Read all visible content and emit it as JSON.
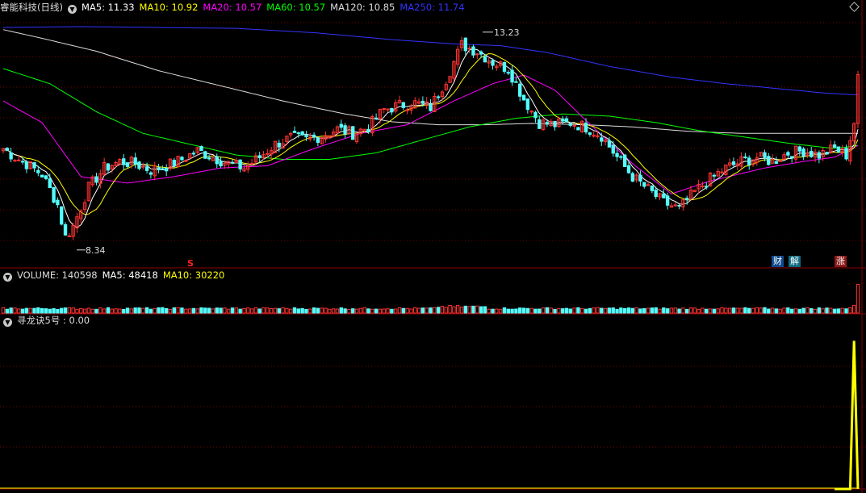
{
  "main_header": {
    "stock_title": "睿能科技(日线)",
    "indicators": [
      {
        "label": "MA5: 11.33",
        "color": "#ffffff"
      },
      {
        "label": "MA10: 10.92",
        "color": "#ffff00"
      },
      {
        "label": "MA20: 10.57",
        "color": "#ff00ff"
      },
      {
        "label": "MA60: 10.57",
        "color": "#00ff00"
      },
      {
        "label": "MA120: 10.85",
        "color": "#dddddd"
      },
      {
        "label": "MA250: 11.74",
        "color": "#3333ff"
      }
    ]
  },
  "volume_header": {
    "label": "VOLUME: 140598",
    "ma5": "MA5: 48418",
    "ma10": "MA10: 30220"
  },
  "indicator_header": {
    "label": "寻龙诀5号 : 0.00"
  },
  "annotations": {
    "high_label": "13.23",
    "low_label": "8.34",
    "s_marker": "S",
    "badge_cai": "财",
    "badge_jie": "解",
    "badge_zhang": "涨"
  },
  "colors": {
    "up": "#ff3333",
    "down": "#54fcfc",
    "ma5": "#ffffff",
    "ma10": "#ffff00",
    "ma20": "#ff00ff",
    "ma60": "#00ff00",
    "ma120": "#dddddd",
    "ma250": "#3333ff",
    "grid": "#7a0000",
    "signal": "#ffff00"
  },
  "chart_data": [
    {
      "type": "candlestick",
      "title": "睿能科技(日线)",
      "annotations": {
        "high": 13.23,
        "low": 8.34
      },
      "close_anchors": [
        [
          0,
          10.5
        ],
        [
          3,
          10.3
        ],
        [
          6,
          10.15
        ],
        [
          10,
          9.9
        ],
        [
          14,
          9.2
        ],
        [
          16,
          8.45
        ],
        [
          18,
          8.7
        ],
        [
          22,
          9.6
        ],
        [
          26,
          10.05
        ],
        [
          30,
          10.2
        ],
        [
          34,
          10.15
        ],
        [
          38,
          10.0
        ],
        [
          42,
          10.1
        ],
        [
          46,
          10.25
        ],
        [
          50,
          10.45
        ],
        [
          54,
          10.3
        ],
        [
          58,
          10.15
        ],
        [
          62,
          10.05
        ],
        [
          66,
          10.3
        ],
        [
          70,
          10.6
        ],
        [
          74,
          10.75
        ],
        [
          78,
          10.7
        ],
        [
          82,
          10.8
        ],
        [
          86,
          10.95
        ],
        [
          90,
          10.85
        ],
        [
          94,
          11.0
        ],
        [
          98,
          11.4
        ],
        [
          102,
          11.5
        ],
        [
          106,
          11.55
        ],
        [
          110,
          11.45
        ],
        [
          114,
          12.1
        ],
        [
          118,
          12.9
        ],
        [
          122,
          12.75
        ],
        [
          126,
          12.5
        ],
        [
          130,
          12.35
        ],
        [
          134,
          11.65
        ],
        [
          138,
          11.1
        ],
        [
          142,
          11.05
        ],
        [
          146,
          11.1
        ],
        [
          150,
          11.0
        ],
        [
          154,
          10.8
        ],
        [
          158,
          10.3
        ],
        [
          162,
          9.85
        ],
        [
          166,
          9.55
        ],
        [
          170,
          9.25
        ],
        [
          174,
          9.1
        ],
        [
          178,
          9.5
        ],
        [
          182,
          9.8
        ],
        [
          186,
          10.05
        ],
        [
          190,
          10.2
        ],
        [
          194,
          10.3
        ],
        [
          198,
          10.2
        ],
        [
          202,
          10.4
        ],
        [
          206,
          10.45
        ],
        [
          210,
          10.35
        ],
        [
          214,
          10.5
        ],
        [
          217,
          10.35
        ],
        [
          219,
          11.1
        ],
        [
          220,
          12.1
        ]
      ],
      "ma_anchors": {
        "MA20": [
          [
            0,
            11.6
          ],
          [
            10,
            11.1
          ],
          [
            20,
            9.85
          ],
          [
            32,
            9.7
          ],
          [
            44,
            9.85
          ],
          [
            56,
            10.05
          ],
          [
            68,
            10.1
          ],
          [
            80,
            10.5
          ],
          [
            92,
            10.85
          ],
          [
            104,
            11.05
          ],
          [
            116,
            11.6
          ],
          [
            126,
            12.0
          ],
          [
            134,
            12.2
          ],
          [
            142,
            11.85
          ],
          [
            150,
            11.15
          ],
          [
            162,
            10.15
          ],
          [
            172,
            9.45
          ],
          [
            182,
            9.75
          ],
          [
            196,
            10.05
          ],
          [
            206,
            10.2
          ],
          [
            214,
            10.3
          ],
          [
            220,
            10.57
          ]
        ],
        "MA60": [
          [
            0,
            12.35
          ],
          [
            12,
            12.0
          ],
          [
            24,
            11.35
          ],
          [
            36,
            10.85
          ],
          [
            48,
            10.6
          ],
          [
            60,
            10.35
          ],
          [
            72,
            10.25
          ],
          [
            84,
            10.25
          ],
          [
            96,
            10.4
          ],
          [
            108,
            10.7
          ],
          [
            120,
            11.0
          ],
          [
            132,
            11.2
          ],
          [
            144,
            11.3
          ],
          [
            156,
            11.25
          ],
          [
            168,
            11.1
          ],
          [
            180,
            10.9
          ],
          [
            192,
            10.75
          ],
          [
            204,
            10.6
          ],
          [
            214,
            10.5
          ],
          [
            220,
            10.57
          ]
        ],
        "MA120": [
          [
            0,
            13.25
          ],
          [
            10,
            13.05
          ],
          [
            24,
            12.75
          ],
          [
            40,
            12.3
          ],
          [
            56,
            11.95
          ],
          [
            72,
            11.6
          ],
          [
            88,
            11.3
          ],
          [
            100,
            11.12
          ],
          [
            112,
            11.05
          ],
          [
            124,
            11.05
          ],
          [
            136,
            11.08
          ],
          [
            150,
            11.05
          ],
          [
            162,
            11.0
          ],
          [
            176,
            10.9
          ],
          [
            190,
            10.85
          ],
          [
            204,
            10.85
          ],
          [
            214,
            10.85
          ],
          [
            220,
            10.85
          ]
        ],
        "MA250": [
          [
            0,
            13.3
          ],
          [
            20,
            13.32
          ],
          [
            40,
            13.3
          ],
          [
            60,
            13.28
          ],
          [
            80,
            13.18
          ],
          [
            100,
            13.02
          ],
          [
            116,
            12.92
          ],
          [
            128,
            12.88
          ],
          [
            140,
            12.72
          ],
          [
            156,
            12.4
          ],
          [
            172,
            12.15
          ],
          [
            186,
            12.0
          ],
          [
            200,
            11.88
          ],
          [
            212,
            11.78
          ],
          [
            220,
            11.74
          ]
        ]
      },
      "ylim": [
        8.0,
        13.6
      ],
      "grid": true,
      "n_bars": 221
    },
    {
      "type": "bar",
      "title": "VOLUME",
      "values": {
        "last": 140598,
        "ma5": 48418,
        "ma10": 30220
      },
      "ylim": [
        0,
        150000
      ],
      "n_bars": 221
    },
    {
      "type": "line",
      "title": "寻龙诀5号",
      "values": {
        "current": 0.0
      },
      "series": [
        {
          "x": [
            214,
            215,
            216,
            217,
            218,
            219,
            220
          ],
          "values": [
            0,
            0,
            0,
            0,
            0,
            1,
            0
          ]
        }
      ],
      "ylim": [
        0,
        1.1
      ]
    }
  ]
}
